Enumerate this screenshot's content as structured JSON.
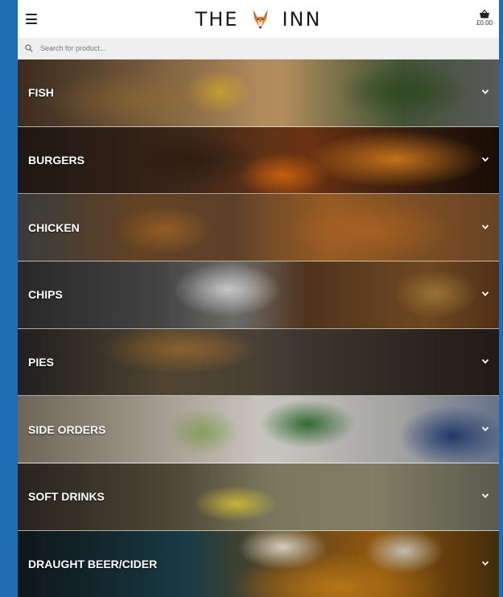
{
  "header": {
    "logo_left": "THE",
    "logo_right": "INN",
    "cart_total": "£0.00"
  },
  "search": {
    "placeholder": "Search for product..."
  },
  "categories": [
    {
      "label": "FISH"
    },
    {
      "label": "BURGERS"
    },
    {
      "label": "CHICKEN"
    },
    {
      "label": "CHIPS"
    },
    {
      "label": "PIES"
    },
    {
      "label": "SIDE ORDERS"
    },
    {
      "label": "SOFT DRINKS"
    },
    {
      "label": "DRAUGHT BEER/CIDER"
    }
  ],
  "icons": {
    "menu": "hamburger-menu-icon",
    "logo": "fox-icon",
    "cart": "basket-icon",
    "search": "search-icon",
    "expand": "chevron-down-icon"
  },
  "colors": {
    "page_background": "#1f6db5",
    "header_background": "#ffffff",
    "search_background": "#efefef",
    "category_text": "#ffffff"
  }
}
